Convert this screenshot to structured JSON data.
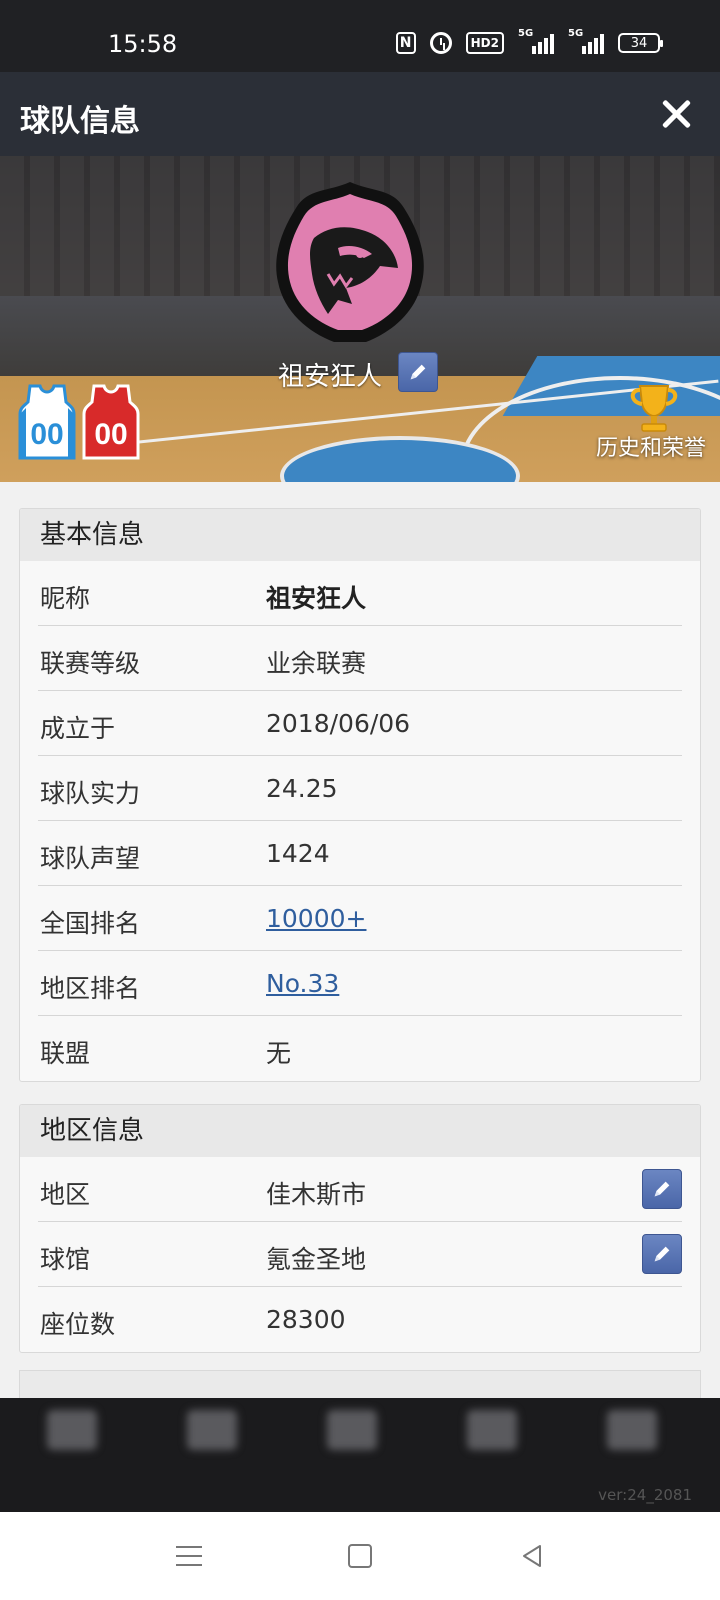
{
  "status_bar": {
    "time": "15:58",
    "hd_label": "HD2",
    "signal1_label": "5G",
    "signal2_label": "5G",
    "battery": "34"
  },
  "header": {
    "title": "球队信息",
    "close_icon": "close-icon"
  },
  "banner": {
    "team_name": "祖安狂人",
    "home_jersey_number": "00",
    "away_jersey_number": "00",
    "history_label": "历史和荣誉",
    "colors": {
      "logo_pink": "#e07fb0",
      "home_jersey": "#2a8fd8",
      "away_jersey": "#d82a2a"
    }
  },
  "basic_info": {
    "heading": "基本信息",
    "rows": [
      {
        "key": "昵称",
        "value": "祖安狂人"
      },
      {
        "key": "联赛等级",
        "value": "业余联赛"
      },
      {
        "key": "成立于",
        "value": "2018/06/06"
      },
      {
        "key": "球队实力",
        "value": "24.25"
      },
      {
        "key": "球队声望",
        "value": "1424"
      },
      {
        "key": "全国排名",
        "value": "10000+"
      },
      {
        "key": "地区排名",
        "value": "No.33"
      },
      {
        "key": "联盟",
        "value": "无"
      }
    ]
  },
  "region_info": {
    "heading": "地区信息",
    "rows": [
      {
        "key": "地区",
        "value": "佳木斯市"
      },
      {
        "key": "球馆",
        "value": "氪金圣地"
      },
      {
        "key": "座位数",
        "value": "28300"
      }
    ]
  },
  "bottom_nav": {
    "version": "ver:24_2081"
  }
}
